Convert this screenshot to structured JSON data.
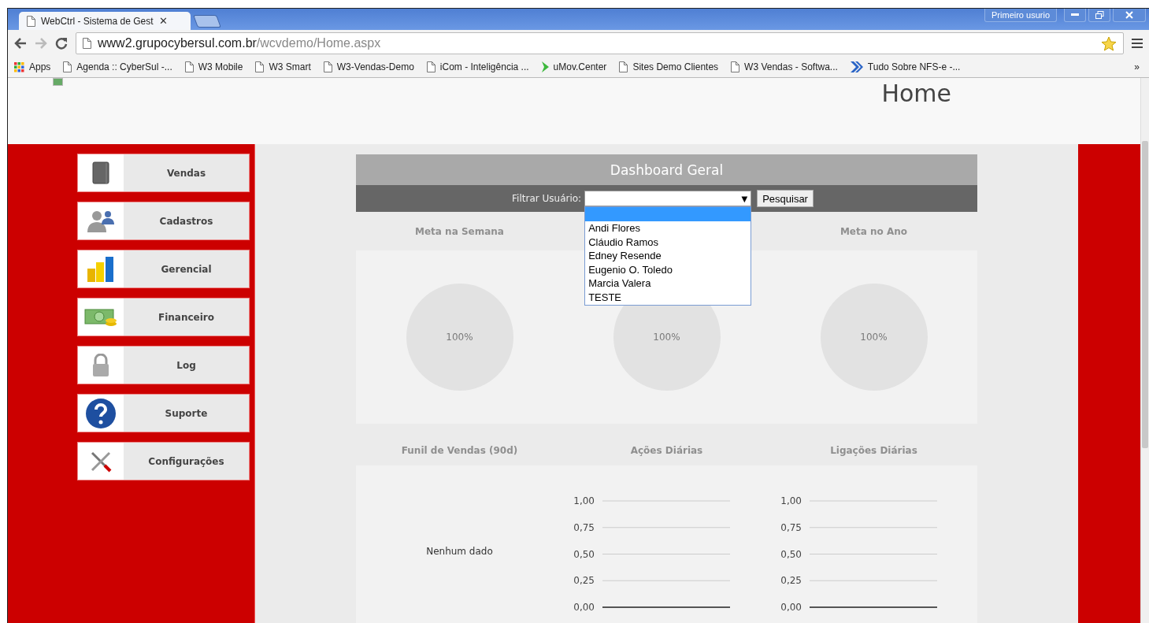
{
  "browser": {
    "tab": {
      "title": "WebCtrl - Sistema de Gest",
      "close": "✕",
      "selected": true
    },
    "profile": "Primeiro usurio",
    "url_host": "www2.grupocybersul.com.br",
    "url_path": "/wcvdemo/Home.aspx",
    "bookmarks": [
      {
        "label": "Apps",
        "kind": "apps"
      },
      {
        "label": "Agenda :: CyberSul -...",
        "kind": "page"
      },
      {
        "label": "W3 Mobile",
        "kind": "page"
      },
      {
        "label": "W3 Smart",
        "kind": "page"
      },
      {
        "label": "W3-Vendas-Demo",
        "kind": "page"
      },
      {
        "label": "iCom - Inteligência ...",
        "kind": "page"
      },
      {
        "label": "uMov.Center",
        "kind": "green"
      },
      {
        "label": "Sites Demo Clientes",
        "kind": "page"
      },
      {
        "label": "W3 Vendas - Softwa...",
        "kind": "page"
      },
      {
        "label": "Tudo Sobre NFS-e -...",
        "kind": "chevron"
      }
    ],
    "overflow": "»"
  },
  "page": {
    "title": "Home",
    "menu": [
      {
        "label": "Vendas",
        "kind": "book"
      },
      {
        "label": "Cadastros",
        "kind": "users"
      },
      {
        "label": "Gerencial",
        "kind": "bars"
      },
      {
        "label": "Financeiro",
        "kind": "money"
      },
      {
        "label": "Log",
        "kind": "lock"
      },
      {
        "label": "Suporte",
        "kind": "help"
      },
      {
        "label": "Configurações",
        "kind": "tools"
      }
    ],
    "dashboard": {
      "title": "Dashboard Geral",
      "filter_label": "Filtrar Usuário:",
      "search_button": "Pesquisar",
      "dropdown": {
        "open": true,
        "blank_option_highlighted": true,
        "arrow": "▼",
        "options": [
          "Andi Flores",
          "Cláudio Ramos",
          "Edney Resende",
          "Eugenio O. Toledo",
          "Marcia Valera",
          "TESTE"
        ]
      },
      "gauges": [
        {
          "title": "Meta na Semana",
          "value": "100%"
        },
        {
          "value": "100%"
        },
        {
          "title": "Meta no Ano",
          "value": "100%"
        }
      ],
      "lower": [
        {
          "title": "Funil de Vendas (90d)",
          "kind": "empty",
          "message": "Nenhum dado"
        },
        {
          "title": "Ações Diárias",
          "kind": "chart",
          "chart_data": {
            "type": "line",
            "grid": true,
            "categories": [
              null,
              null,
              null,
              null,
              null,
              null,
              null
            ],
            "series": [
              {
                "color": "#555555",
                "values": [
                  0,
                  0,
                  0,
                  0,
                  0,
                  0,
                  0
                ]
              }
            ],
            "ylim": [
              0,
              1
            ],
            "yticks": [
              {
                "value": 1,
                "label": "1,00"
              },
              {
                "value": 0.75,
                "label": "0,75"
              },
              {
                "value": 0.5,
                "label": "0,50"
              },
              {
                "value": 0.25,
                "label": "0,25"
              },
              {
                "value": 0,
                "label": "0,00"
              }
            ]
          }
        },
        {
          "title": "Ligações Diárias",
          "kind": "chart",
          "chart_data": {
            "type": "line",
            "grid": true,
            "categories": [
              null,
              null,
              null,
              null,
              null,
              null,
              null
            ],
            "series": [
              {
                "color": "#555555",
                "values": [
                  0,
                  0,
                  0,
                  0,
                  0,
                  0,
                  0
                ]
              }
            ],
            "ylim": [
              0,
              1
            ],
            "yticks": [
              {
                "value": 1,
                "label": "1,00"
              },
              {
                "value": 0.75,
                "label": "0,75"
              },
              {
                "value": 0.5,
                "label": "0,50"
              },
              {
                "value": 0.25,
                "label": "0,25"
              },
              {
                "value": 0,
                "label": "0,00"
              }
            ]
          }
        }
      ]
    }
  }
}
